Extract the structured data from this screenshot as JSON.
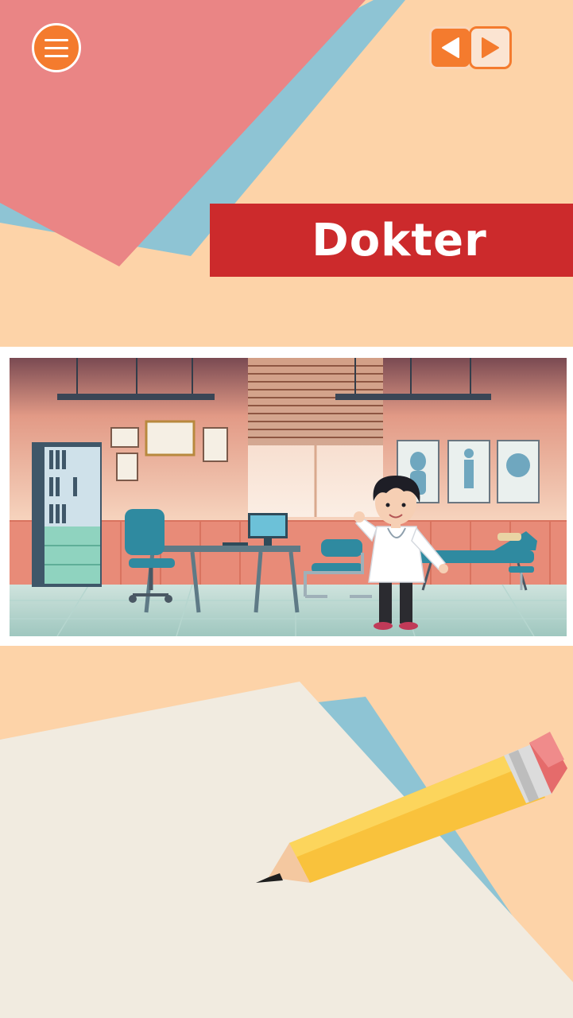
{
  "header": {
    "title": "Dokter"
  },
  "toolbar": {
    "menu_icon": "hamburger-menu-icon",
    "prev_icon": "triangle-left-icon",
    "next_icon": "triangle-right-icon"
  },
  "scene": {
    "subject": "doctor-office-illustration"
  },
  "colors": {
    "background": "#fdd3a8",
    "banner": "#cc2a2c",
    "accent": "#f47b2e",
    "paper_pink": "#ea8585",
    "paper_blue": "#8ec4d4",
    "paper_cream": "#f1ebe0",
    "pencil": "#f9c23c"
  }
}
